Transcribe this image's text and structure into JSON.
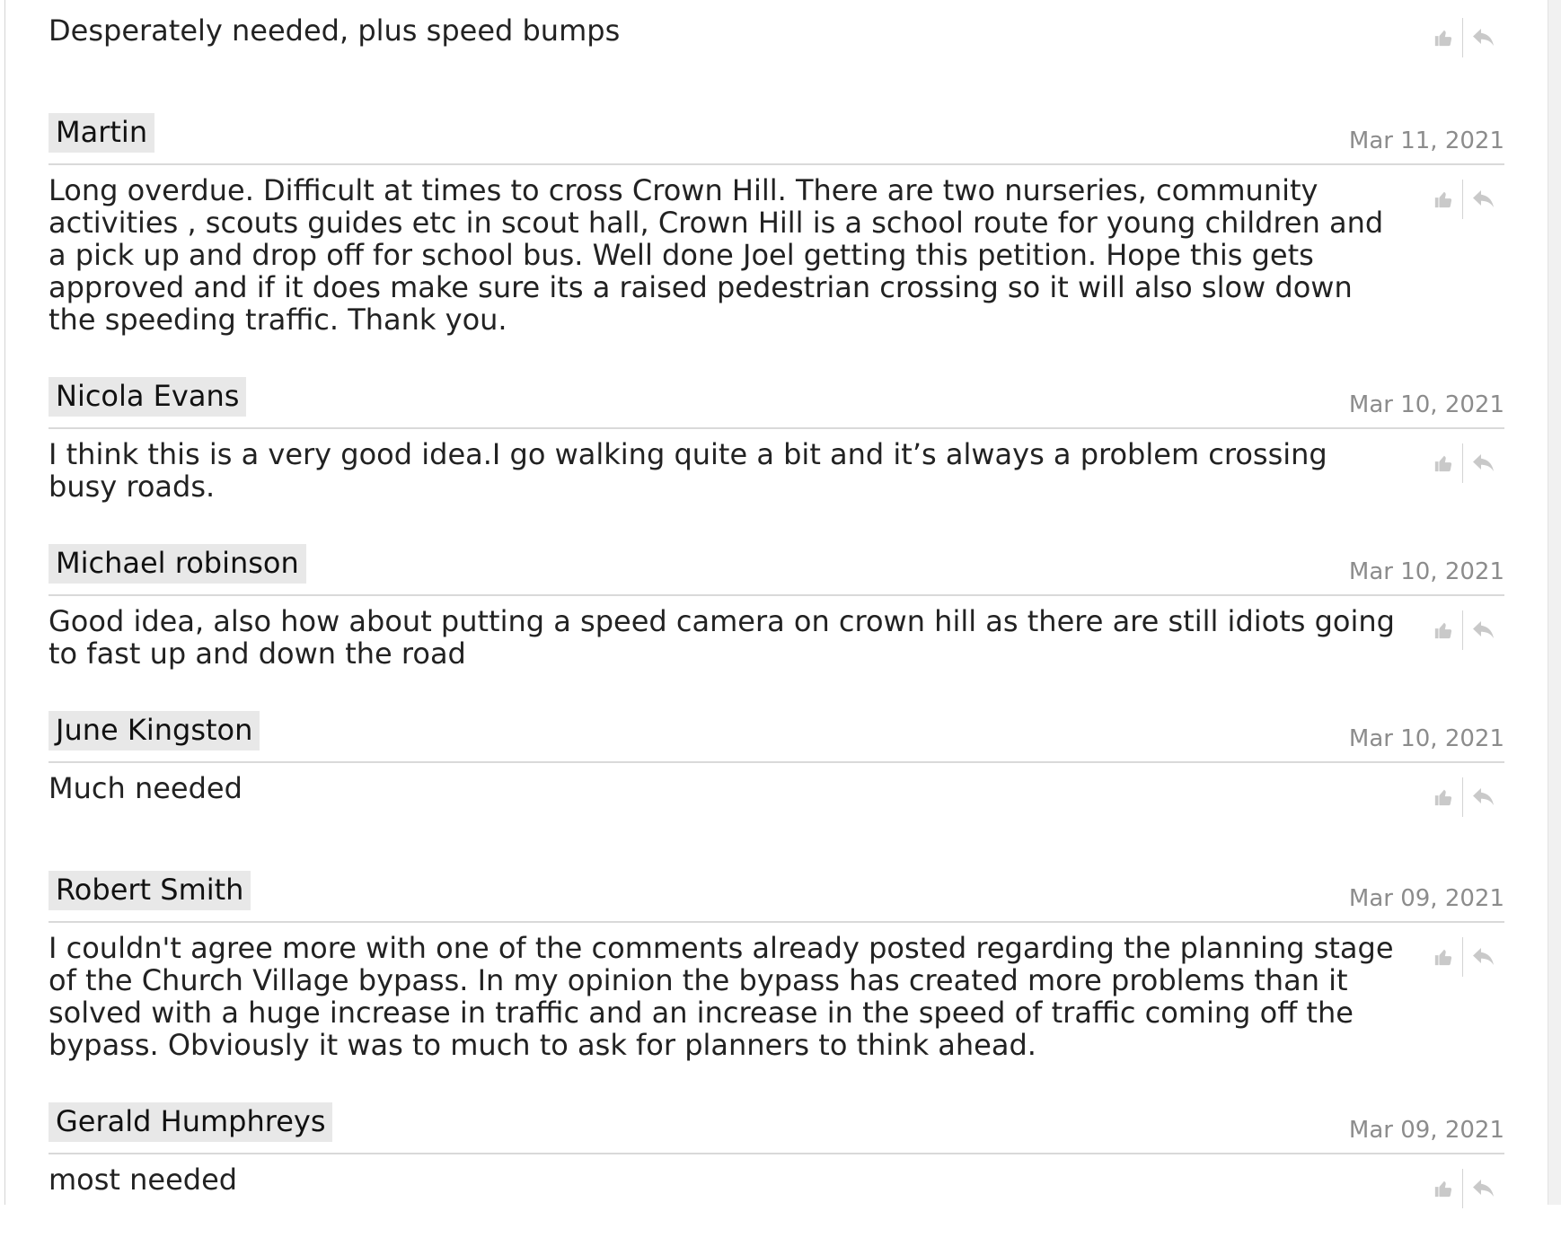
{
  "ui": {
    "icon_color": "#c9c9c9",
    "author_bg": "#e8e8e8",
    "divider_color": "#d9d9d9",
    "date_color": "#8c8c8c"
  },
  "first_comment": {
    "text": "Desperately needed, plus speed bumps",
    "like_icon": "thumbs-up-icon",
    "reply_icon": "reply-arrow-icon"
  },
  "comments": [
    {
      "author": "Martin",
      "date": "Mar 11, 2021",
      "text": "Long overdue. Difficult at times to cross Crown Hill. There are two nurseries, community activities , scouts guides etc in scout hall, Crown Hill is a school route for young children and a pick up and drop off for school bus. Well done Joel getting this petition. Hope this gets approved and if it does make sure its a raised pedestrian crossing so it will also slow down the speeding traffic. Thank you."
    },
    {
      "author": "Nicola Evans",
      "date": "Mar 10, 2021",
      "text": "I think this is a very good idea.I go walking quite a bit and it’s always a problem crossing busy roads."
    },
    {
      "author": "Michael robinson",
      "date": "Mar 10, 2021",
      "text": "Good idea, also how about putting a speed camera on crown hill as there are still idiots going to fast up and down the road"
    },
    {
      "author": "June Kingston",
      "date": "Mar 10, 2021",
      "text": "Much needed"
    },
    {
      "author": "Robert Smith",
      "date": "Mar 09, 2021",
      "text": "I couldn't agree more with one of the comments already posted regarding the planning stage of the Church Village bypass. In my opinion the bypass has created more problems than it solved with a huge increase in traffic and an increase in the speed of traffic coming off the bypass. Obviously it was to much to ask for planners to think ahead."
    },
    {
      "author": "Gerald Humphreys",
      "date": "Mar 09, 2021",
      "text": "most needed"
    }
  ]
}
